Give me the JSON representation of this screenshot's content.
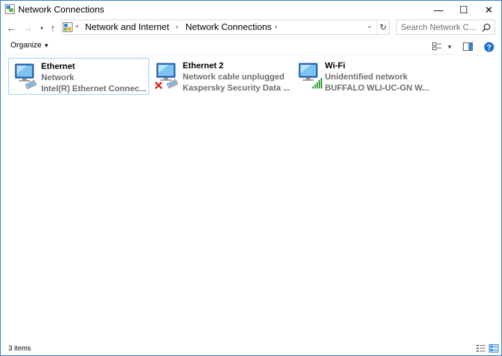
{
  "window": {
    "title": "Network Connections",
    "controls": {
      "minimize": "—",
      "maximize": "☐",
      "close": "✕"
    }
  },
  "address": {
    "overflow": "«",
    "crumbs": [
      "Network and Internet",
      "Network Connections"
    ],
    "separator": "›"
  },
  "search": {
    "placeholder": "Search Network C..."
  },
  "toolbar": {
    "organize_label": "Organize"
  },
  "connections": [
    {
      "name": "Ethernet",
      "status": "Network",
      "device": "Intel(R) Ethernet Connec...",
      "type": "ethernet",
      "selected": true
    },
    {
      "name": "Ethernet 2",
      "status": "Network cable unplugged",
      "device": "Kaspersky Security Data ...",
      "type": "ethernet-disconnected",
      "selected": false
    },
    {
      "name": "Wi-Fi",
      "status": "Unidentified network",
      "device": "BUFFALO WLI-UC-GN W...",
      "type": "wifi",
      "selected": false
    }
  ],
  "statusbar": {
    "item_count": "3 items"
  },
  "colors": {
    "accent": "#2b79d1",
    "selection_border": "#99d1ff",
    "secondary_text": "#6d6d6d",
    "error_red": "#d9261c",
    "signal_green": "#2e9e2e"
  }
}
